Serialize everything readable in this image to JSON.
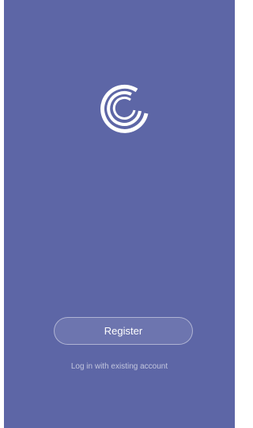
{
  "app": {
    "background_color": "#5d66a6",
    "logo_icon": "concentric-c-arcs-logo"
  },
  "actions": {
    "register_label": "Register",
    "login_link_label": "Log in with existing account"
  }
}
